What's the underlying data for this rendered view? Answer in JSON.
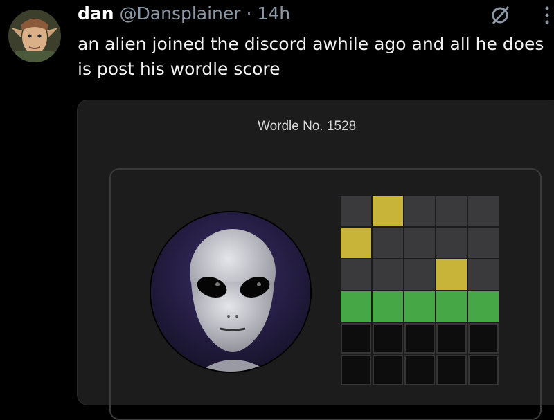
{
  "tweet": {
    "display_name": "dan",
    "handle": "@Dansplainer",
    "separator": "·",
    "time": "14h",
    "text": "an alien joined the discord awhile ago and all he does is post his wordle score",
    "avatar_icon": "elf-avatar",
    "grok_icon": "grok-icon",
    "more_icon": "more-options-icon"
  },
  "wordle": {
    "title": "Wordle No. 1528",
    "image_icon": "alien-face",
    "rows": [
      [
        "gray",
        "yellow",
        "gray",
        "gray",
        "gray"
      ],
      [
        "yellow",
        "gray",
        "gray",
        "gray",
        "gray"
      ],
      [
        "gray",
        "gray",
        "gray",
        "yellow",
        "gray"
      ],
      [
        "green",
        "green",
        "green",
        "green",
        "green"
      ],
      [
        "empty",
        "empty",
        "empty",
        "empty",
        "empty"
      ],
      [
        "empty",
        "empty",
        "empty",
        "empty",
        "empty"
      ]
    ]
  },
  "colors": {
    "background": "#000000",
    "card": "#1c1c1c",
    "gray": "#3a3a3c",
    "yellow": "#c9b43a",
    "green": "#45a745",
    "muted_text": "#8b98a5"
  }
}
